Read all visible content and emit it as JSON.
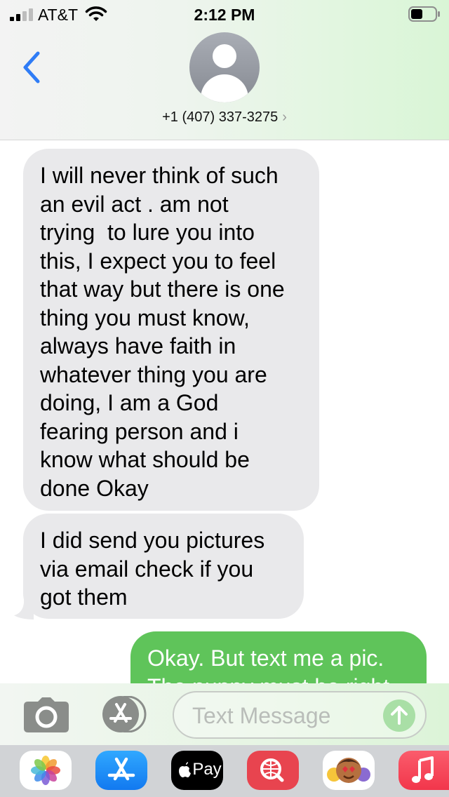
{
  "status_bar": {
    "carrier": "AT&T",
    "time": "2:12 PM",
    "signal_bars": 4,
    "signal_bars_filled": 2
  },
  "header": {
    "contact": "+1 (407) 337-3275",
    "chevron": "›",
    "back_icon": "chevron-left-icon",
    "avatar_icon": "person-silhouette-icon"
  },
  "messages": [
    {
      "direction": "incoming",
      "text": "I will never think of such\nan evil act . am not\ntrying  to lure you into\nthis, I expect you to feel\nthat way but there is one\nthing you must know,\nalways have faith in\nwhatever thing you are\ndoing, I am a God\nfearing person and i\nknow what should be\ndone Okay"
    },
    {
      "direction": "incoming",
      "text": "I did send you pictures\nvia email check if you\ngot them"
    },
    {
      "direction": "outgoing",
      "text": "Okay. But text me a pic.\nThe puppy must be right"
    }
  ],
  "compose": {
    "placeholder": "Text Message",
    "camera_icon": "camera-icon",
    "apps_icon": "app-store-icon",
    "send_icon": "send-arrow-up-icon"
  },
  "app_drawer": {
    "apps": [
      {
        "name": "Photos",
        "icon": "photos-icon"
      },
      {
        "name": "App Store",
        "icon": "app-store-icon"
      },
      {
        "name": "Apple Pay",
        "icon": "apple-pay-icon",
        "label": "Pay"
      },
      {
        "name": "Web Search",
        "icon": "web-search-icon"
      },
      {
        "name": "Memoji",
        "icon": "memoji-icon"
      },
      {
        "name": "Music",
        "icon": "music-icon"
      }
    ]
  },
  "colors": {
    "incoming_bubble": "#e9e9eb",
    "outgoing_bubble": "#5fc45a",
    "accent_blue": "#2f7cf6"
  }
}
